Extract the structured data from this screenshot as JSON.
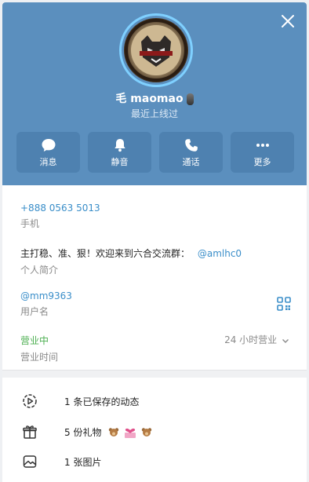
{
  "profile": {
    "name": "毛 maomao",
    "status": "最近上线过"
  },
  "actions": [
    {
      "label": "消息",
      "icon": "message-icon"
    },
    {
      "label": "静音",
      "icon": "bell-icon"
    },
    {
      "label": "通话",
      "icon": "phone-icon"
    },
    {
      "label": "更多",
      "icon": "more-icon"
    }
  ],
  "info": {
    "phone": "+888 0563 5013",
    "phone_label": "手机",
    "bio": "主打稳、准、狠！欢迎来到六合交流群：",
    "bio_link": "@amlhc0",
    "bio_label": "个人简介",
    "username": "@mm9363",
    "username_label": "用户名",
    "business_status": "营业中",
    "business_label": "营业时间",
    "hours": "24 小时营业"
  },
  "menu": {
    "stories": "1 条已保存的动态",
    "gifts": "5 份礼物",
    "photos": "1 张图片"
  },
  "colors": {
    "header": "#5b8fbe",
    "accent": "#3a8ec9",
    "open_green": "#4caf50"
  }
}
